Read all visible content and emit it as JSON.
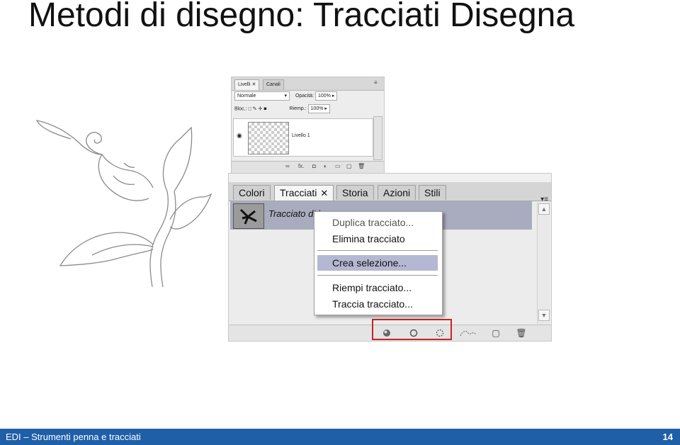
{
  "slide": {
    "title": "Metodi di disegno: Tracciati Disegna"
  },
  "layers_panel": {
    "tabs": [
      "Livelli",
      "Canali"
    ],
    "blend_mode": "Normale",
    "opacity_label": "Opacità:",
    "opacity_value": "100%",
    "lock_label": "Bloc.:",
    "fill_label": "Riemp.:",
    "fill_value": "100%",
    "layer_name": "Livello 1"
  },
  "paths_panel": {
    "tabs": [
      "Colori",
      "Tracciati",
      "Storia",
      "Azioni",
      "Stili"
    ],
    "active_tab_close": "✕",
    "path_name": "Tracciato di l"
  },
  "context_menu": {
    "items": [
      "Duplica tracciato...",
      "Elimina tracciato",
      "Crea selezione...",
      "Riempi tracciato...",
      "Traccia tracciato..."
    ]
  },
  "footer": {
    "left": "EDI – Strumenti penna e tracciati",
    "page": "14"
  },
  "colors": {
    "footer_bg": "#1f5fa8",
    "selected_row": "#a9abbf",
    "menu_highlight": "#b4b8d2",
    "highlight_border": "#c42626"
  }
}
